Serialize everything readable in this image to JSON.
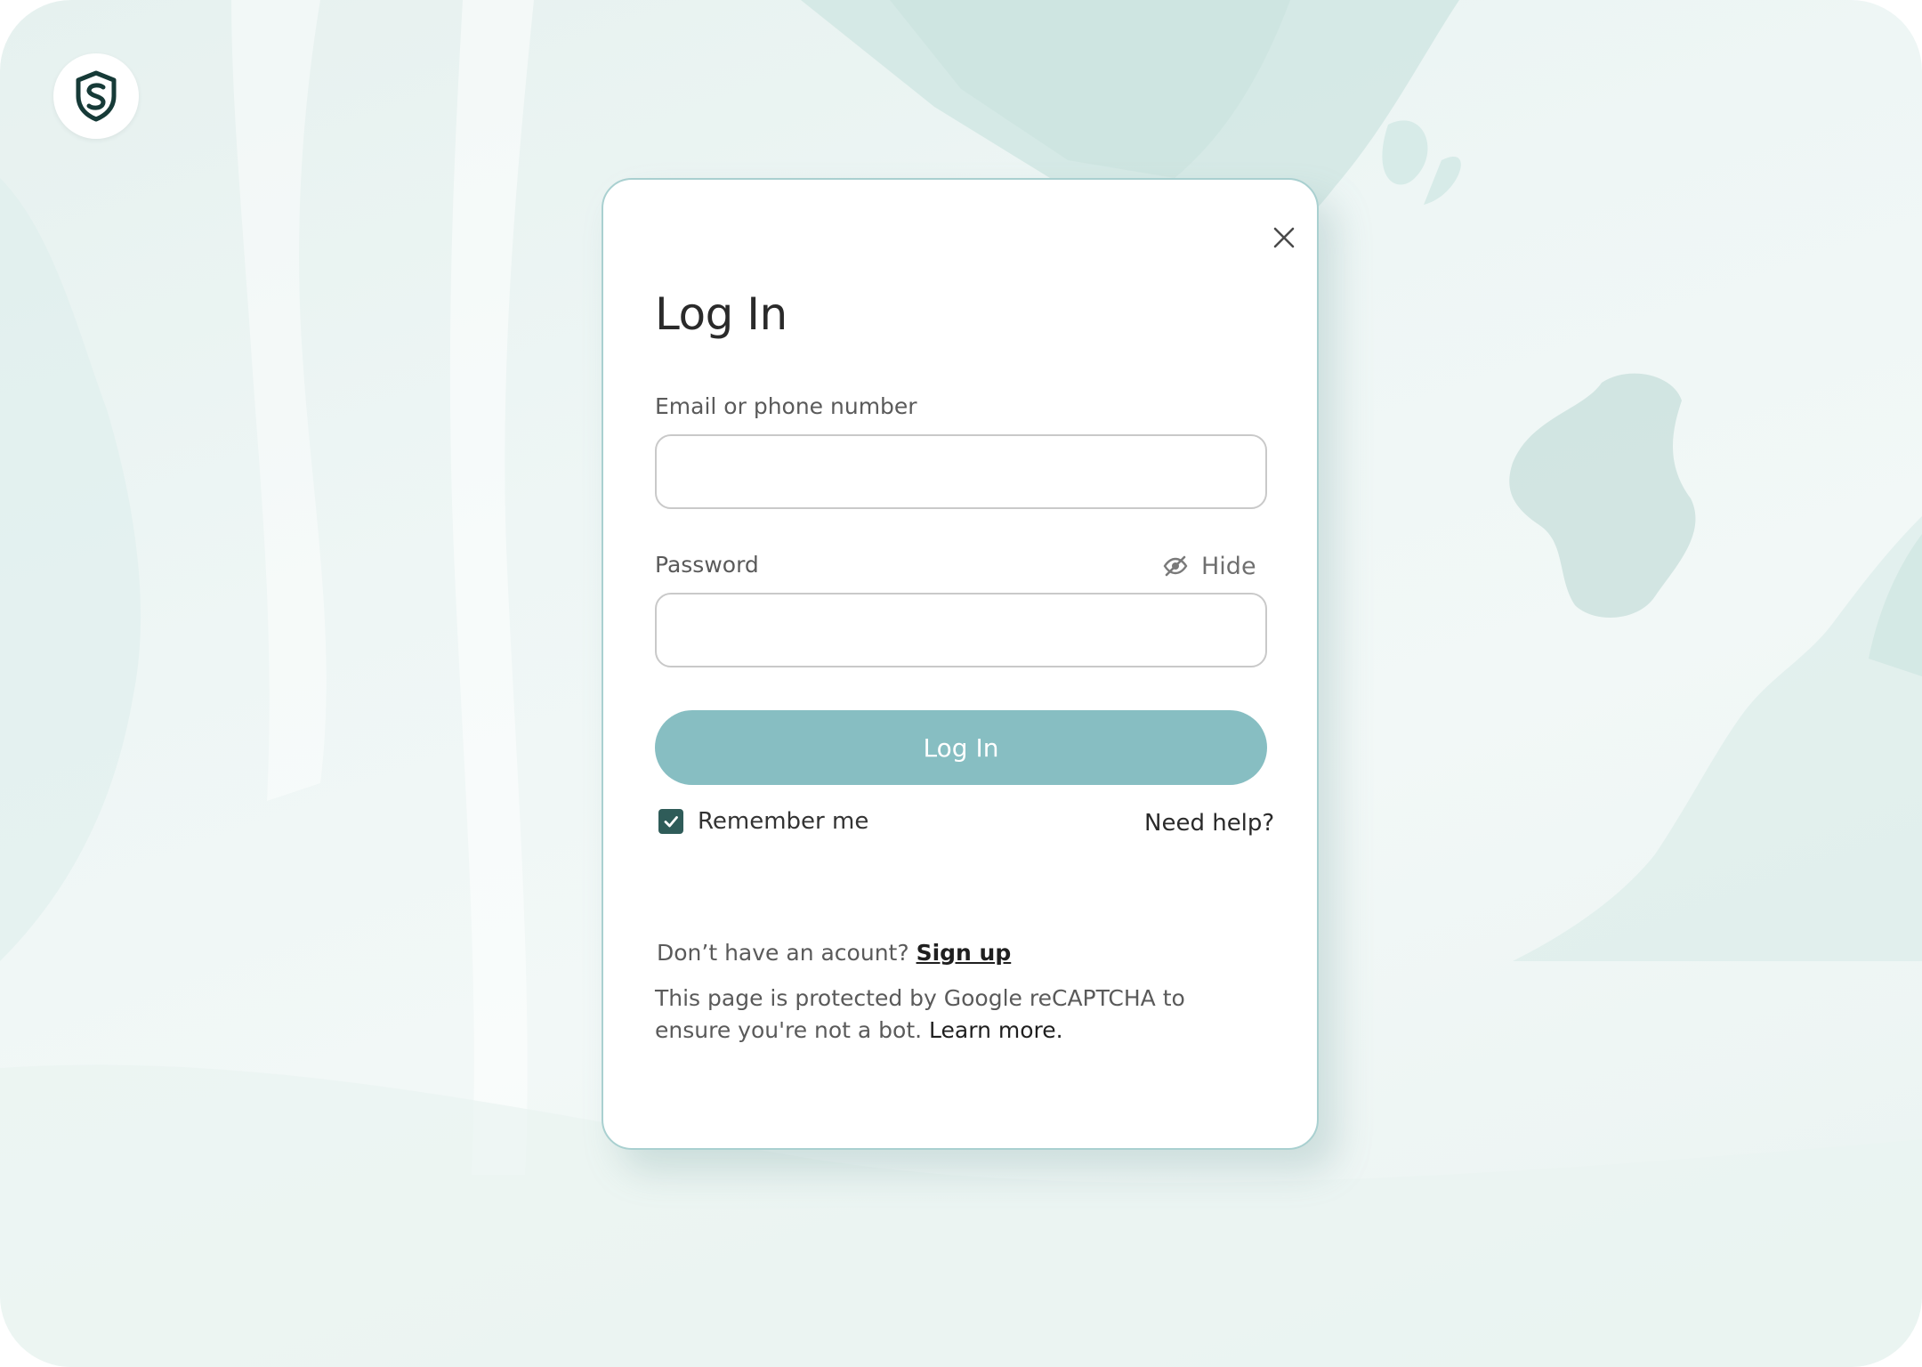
{
  "brand": {
    "logo_icon": "shield-sc-logo-icon",
    "accent_color": "#87bec2",
    "dark_color": "#163a37"
  },
  "login": {
    "title": "Log In",
    "email_label": "Email or phone number",
    "email_value": "",
    "password_label": "Password",
    "password_value": "",
    "hide_label": "Hide",
    "hide_icon": "eye-slash-icon",
    "submit_label": "Log In",
    "remember_label": "Remember me",
    "remember_checked": true,
    "need_help": "Need help?",
    "close_icon": "close-icon"
  },
  "footer": {
    "no_account": "Don’t have an acount?",
    "signup_link": "Sign up",
    "captcha_text": "This page is protected by Google reCAPTCHA to ensure you're not a bot.",
    "learn_more": "Learn more."
  }
}
